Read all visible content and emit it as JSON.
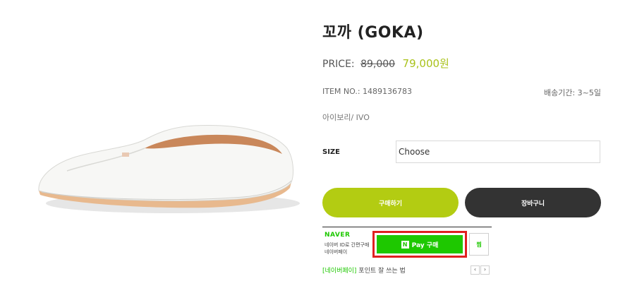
{
  "product": {
    "name": "꼬까 (GOKA)",
    "price_label": "PRICE:",
    "original_price": "89,000",
    "sale_price": "79,000원",
    "item_no": "ITEM NO.: 1489136783",
    "shipping": "배송기간: 3~5일",
    "color_option": "아이보리/ IVO"
  },
  "size": {
    "label": "SIZE",
    "selected": "Choose"
  },
  "actions": {
    "buy_label": "구매하기",
    "cart_label": "장바구니"
  },
  "naver_pay": {
    "brand": "NAVER",
    "desc_line1": "네이버 ID로 간편구매",
    "desc_line2": "네이버페이",
    "n_badge": "N",
    "button_label": "Pay 구매",
    "wish_label": "찜",
    "promo_tag": "[네이버페이]",
    "promo_text": " 포인트 잘 쓰는 법",
    "prev": "‹",
    "next": "›"
  },
  "colors": {
    "accent_green": "#b3cc12",
    "naver_green": "#1ec800",
    "dark_button": "#333333",
    "highlight_red": "#e02020"
  }
}
